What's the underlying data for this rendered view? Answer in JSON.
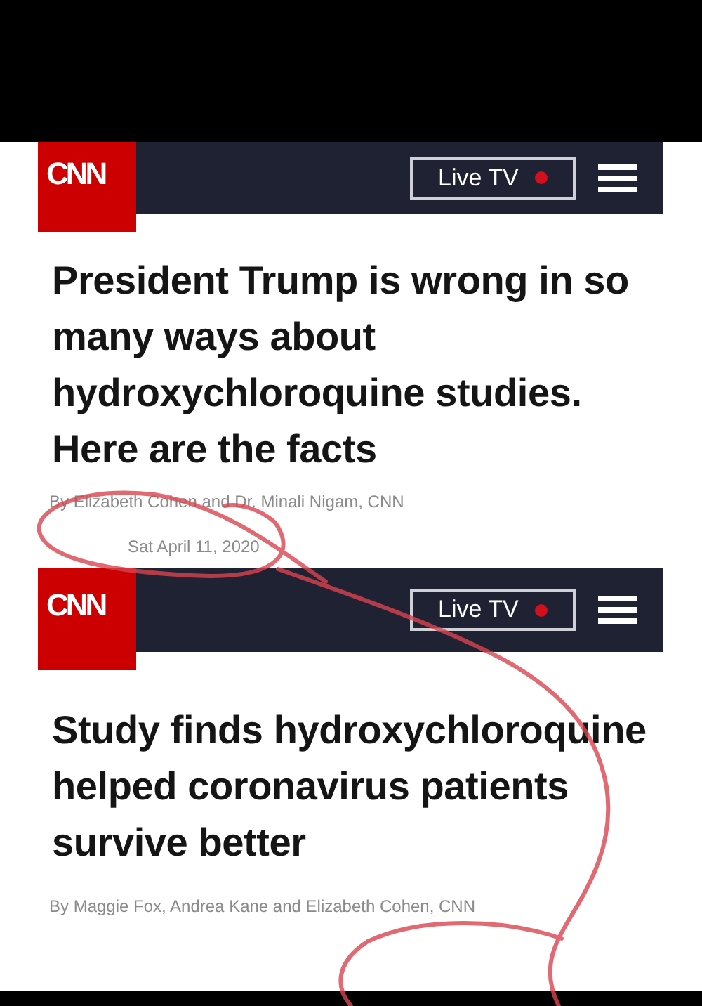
{
  "articles": [
    {
      "logo": "CNN",
      "live_button": "Live TV",
      "headline": "President Trump is wrong in so many ways about hydroxychloroquine studies. Here are the facts",
      "byline": "By Elizabeth Cohen and Dr. Minali Nigam, CNN",
      "dateline": "Sat April 11, 2020"
    },
    {
      "logo": "CNN",
      "live_button": "Live TV",
      "headline": "Study finds hydroxychloroquine helped coronavirus patients survive better",
      "byline": "By Maggie Fox, Andrea Kane and Elizabeth Cohen, CNN"
    }
  ]
}
